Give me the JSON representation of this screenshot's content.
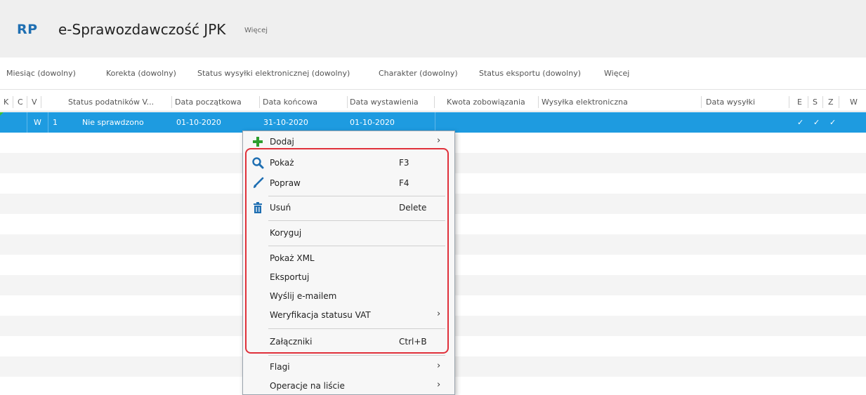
{
  "header": {
    "logo": "RP",
    "title": "e-Sprawozdawczość JPK",
    "more": "Więcej"
  },
  "filters": [
    "Miesiąc (dowolny)",
    "Korekta (dowolny)",
    "Status wysyłki elektronicznej (dowolny)",
    "Charakter (dowolny)",
    "Status eksportu (dowolny)",
    "Więcej"
  ],
  "columns": [
    "K",
    "C",
    "V",
    "Status podatników V...",
    "Data początkowa",
    "Data końcowa",
    "Data wystawienia",
    "Kwota zobowiązania",
    "Wysyłka elektroniczna",
    "Data wysyłki",
    "E",
    "S",
    "Z",
    "W"
  ],
  "row": {
    "c": "W",
    "v": "1",
    "status": "Nie sprawdzono",
    "date_start": "01-10-2020",
    "date_end": "31-10-2020",
    "date_issue": "01-10-2020",
    "e": "✓",
    "s": "✓",
    "z": "✓"
  },
  "menu": {
    "add": "Dodaj",
    "show": "Pokaż",
    "show_sc": "F3",
    "edit": "Popraw",
    "edit_sc": "F4",
    "delete": "Usuń",
    "delete_sc": "Delete",
    "correct": "Koryguj",
    "show_xml": "Pokaż XML",
    "export": "Eksportuj",
    "email": "Wyślij e-mailem",
    "vat": "Weryfikacja statusu VAT",
    "attachments": "Załączniki",
    "attachments_sc": "Ctrl+B",
    "flags": "Flagi",
    "list_ops": "Operacje na liście",
    "submenu_arrow": "›"
  },
  "colors": {
    "accent": "#1e9be0",
    "highlight": "#e0303a",
    "add_icon": "#2e9e2e",
    "icon_blue": "#1f6fb2"
  }
}
